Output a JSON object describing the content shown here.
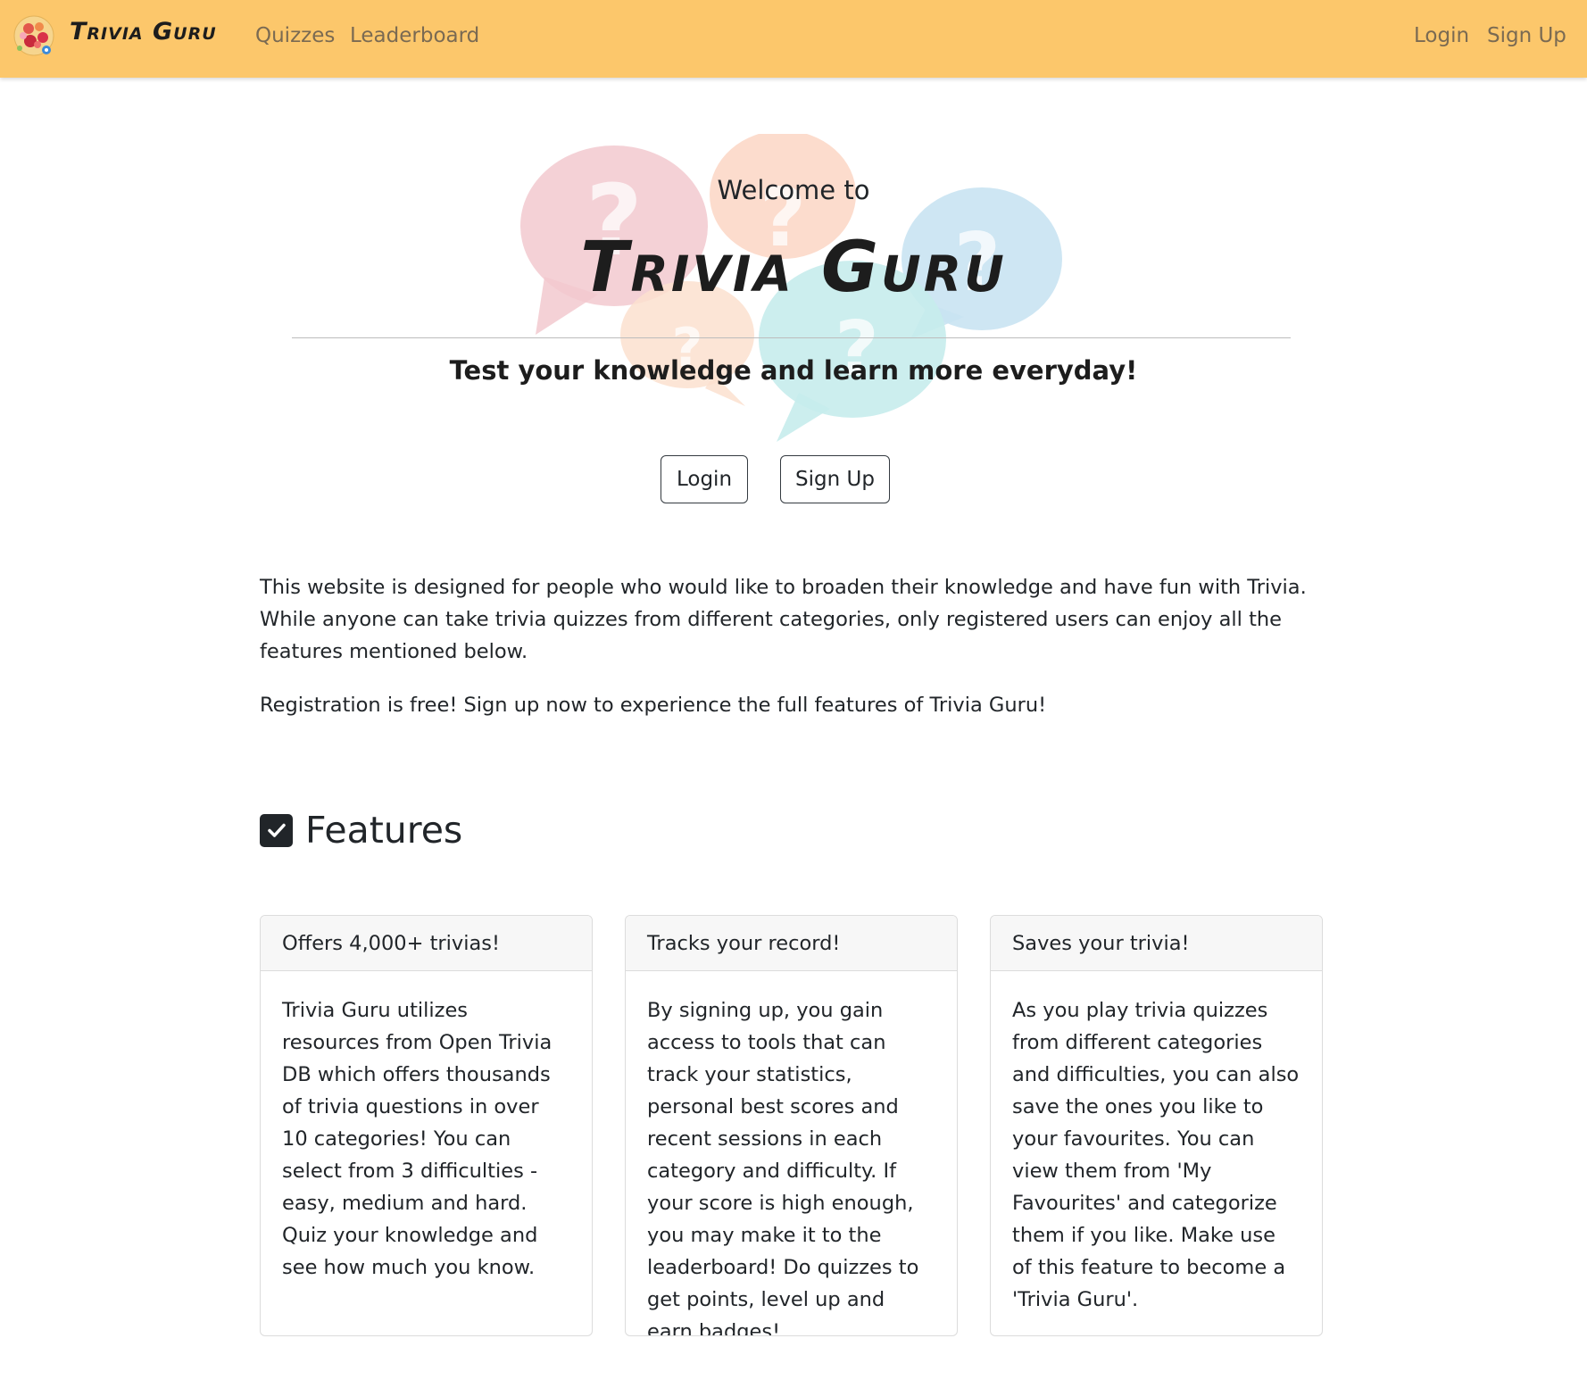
{
  "navbar": {
    "brand": "Trivia Guru",
    "links": {
      "quizzes": "Quizzes",
      "leaderboard": "Leaderboard"
    },
    "auth": {
      "login": "Login",
      "signup": "Sign Up"
    },
    "background_color": "#fcc76b"
  },
  "hero": {
    "welcome": "Welcome to",
    "title": "Trivia Guru",
    "tagline": "Test your knowledge and learn more everyday!",
    "login_button": "Login",
    "signup_button": "Sign Up",
    "bubble_colors": [
      "#f2c9cf",
      "#fbd6c4",
      "#c9e3f2",
      "#c6ecec",
      "#fce0cf"
    ]
  },
  "intro": {
    "paragraph1": "This website is designed for people who would like to broaden their knowledge and have fun with Trivia. While anyone can take trivia quizzes from different categories, only registered users can enjoy all the features mentioned below.",
    "paragraph2": "Registration is free! Sign up now to experience the full features of Trivia Guru!"
  },
  "features": {
    "heading": "Features",
    "icon": "check-square-icon",
    "cards": [
      {
        "title": "Offers 4,000+ trivias!",
        "body": "Trivia Guru utilizes resources from Open Trivia DB which offers thousands of trivia questions in over 10 categories! You can select from 3 difficulties - easy, medium and hard. Quiz your knowledge and see how much you know."
      },
      {
        "title": "Tracks your record!",
        "body": "By signing up, you gain access to tools that can track your statistics, personal best scores and recent sessions in each category and difficulty. If your score is high enough, you may make it to the leaderboard! Do quizzes to get points, level up and earn badges!"
      },
      {
        "title": "Saves your trivia!",
        "body": "As you play trivia quizzes from different categories and difficulties, you can also save the ones you like to your favourites. You can view them from 'My Favourites' and categorize them if you like. Make use of this feature to become a 'Trivia Guru'."
      }
    ]
  }
}
